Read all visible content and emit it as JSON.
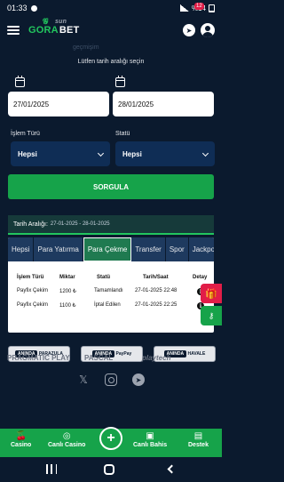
{
  "status_bar": {
    "time": "01:33",
    "battery": "%14"
  },
  "header": {
    "logo_main": "GORA",
    "logo_accent": "BET",
    "logo_sub": "sun",
    "ghost_text": "geçmişim",
    "notification_count": "12"
  },
  "date_filter": {
    "prompt": "Lütfen tarih aralığı seçin",
    "start_date": "27/01/2025",
    "end_date": "28/01/2025"
  },
  "filters": {
    "type_label": "İşlem Türü",
    "type_value": "Hepsi",
    "status_label": "Statü",
    "status_value": "Hepsi"
  },
  "query_button": "SORGULA",
  "range": {
    "label": "Tarih Aralığı:",
    "value": "27-01-2025 - 28-01-2025"
  },
  "tabs": [
    {
      "label": "Hepsi",
      "active": false
    },
    {
      "label": "Para Yatırma",
      "active": false
    },
    {
      "label": "Para Çekme",
      "active": true
    },
    {
      "label": "Transfer",
      "active": false
    },
    {
      "label": "Spor",
      "active": false
    },
    {
      "label": "Jackpot",
      "active": false
    }
  ],
  "table": {
    "headers": [
      "İşlem Türü",
      "Miktar",
      "Statü",
      "Tarih/Saat",
      "Detay"
    ],
    "rows": [
      {
        "type": "Payfix Çekim",
        "amount": "1200 ₺",
        "status": "Tamamlandı",
        "datetime": "27-01-2025 22:48"
      },
      {
        "type": "Payfix Çekim",
        "amount": "1100 ₺",
        "status": "İptal Edilen",
        "datetime": "27-01-2025 22:25"
      }
    ]
  },
  "providers": [
    {
      "top": "ANINDA",
      "bottom": "PARAZULA"
    },
    {
      "top": "ANINDA",
      "bottom": "PayPay"
    },
    {
      "top": "ANINDA",
      "bottom": "HAVALE"
    }
  ],
  "partners": [
    "PRAGMATIC PLAY",
    "PASCAL",
    "playtech"
  ],
  "socials": [
    "x-icon",
    "instagram-icon",
    "telegram-icon"
  ],
  "bottom_nav": [
    {
      "label": "Casino",
      "icon": "cherries-icon"
    },
    {
      "label": "Canlı Casino",
      "icon": "chip-icon"
    },
    {
      "label": "Canlı Bahis",
      "icon": "tv-icon"
    },
    {
      "label": "Destek",
      "icon": "chat-icon"
    }
  ],
  "colors": {
    "background": "#0b1a2e",
    "accent": "#16a34a",
    "select_bg": "#0f2d55"
  }
}
